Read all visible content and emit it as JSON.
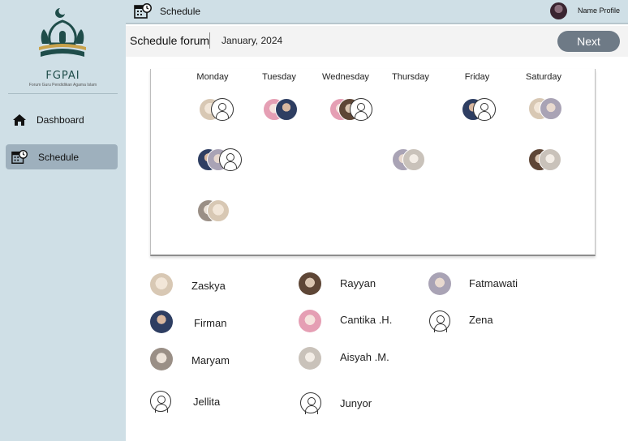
{
  "sidebar": {
    "logo_title": "FGPAI",
    "logo_subtitle": "Forum Guru Pendidikan Agama Islam",
    "items": [
      {
        "label": "Dashboard",
        "icon": "home-icon"
      },
      {
        "label": "Schedule",
        "icon": "calendar-clock-icon",
        "active": true
      }
    ]
  },
  "topbar": {
    "title": "Schedule",
    "profile_label": "Name Profile"
  },
  "header": {
    "title": "Schedule forum",
    "month": "January, 2024",
    "next_label": "Next"
  },
  "schedule": {
    "days": [
      "Monday",
      "Tuesday",
      "Wednesday",
      "Thursday",
      "Friday",
      "Saturday"
    ]
  },
  "members": [
    {
      "name": "Zaskya"
    },
    {
      "name": "Firman"
    },
    {
      "name": "Maryam"
    },
    {
      "name": "Jellita"
    },
    {
      "name": "Rayyan"
    },
    {
      "name": "Cantika .H."
    },
    {
      "name": "Aisyah .M."
    },
    {
      "name": "Junyor"
    },
    {
      "name": "Fatmawati"
    },
    {
      "name": "Zena"
    }
  ],
  "colors": {
    "sidebar_bg": "#cfdfe6",
    "active_item_bg": "#9eb0bd",
    "next_button_bg": "#6e7a86",
    "logo_green": "#1f4d4a"
  }
}
